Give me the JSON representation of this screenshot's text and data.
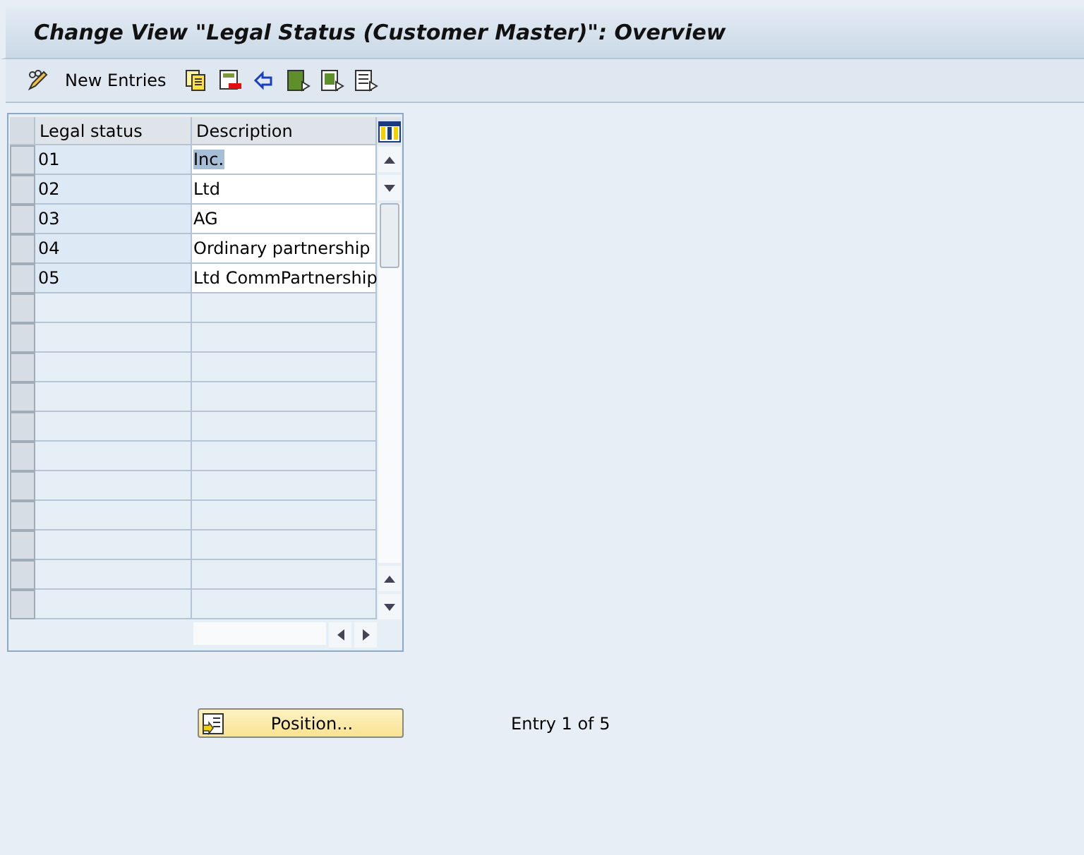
{
  "window": {
    "title": "Change View \"Legal Status (Customer Master)\": Overview"
  },
  "toolbar": {
    "new_entries": "New Entries"
  },
  "table": {
    "columns": [
      "Legal status",
      "Description"
    ],
    "rows": [
      {
        "legal_status": "01",
        "description": "Inc.",
        "text_selected": true
      },
      {
        "legal_status": "02",
        "description": "Ltd",
        "text_selected": false
      },
      {
        "legal_status": "03",
        "description": "AG",
        "text_selected": false
      },
      {
        "legal_status": "04",
        "description": "Ordinary partnership",
        "text_selected": false
      },
      {
        "legal_status": "05",
        "description": "Ltd CommPartnership",
        "text_selected": false
      }
    ]
  },
  "position_button": "Position...",
  "entry_info": "Entry 1 of 5"
}
